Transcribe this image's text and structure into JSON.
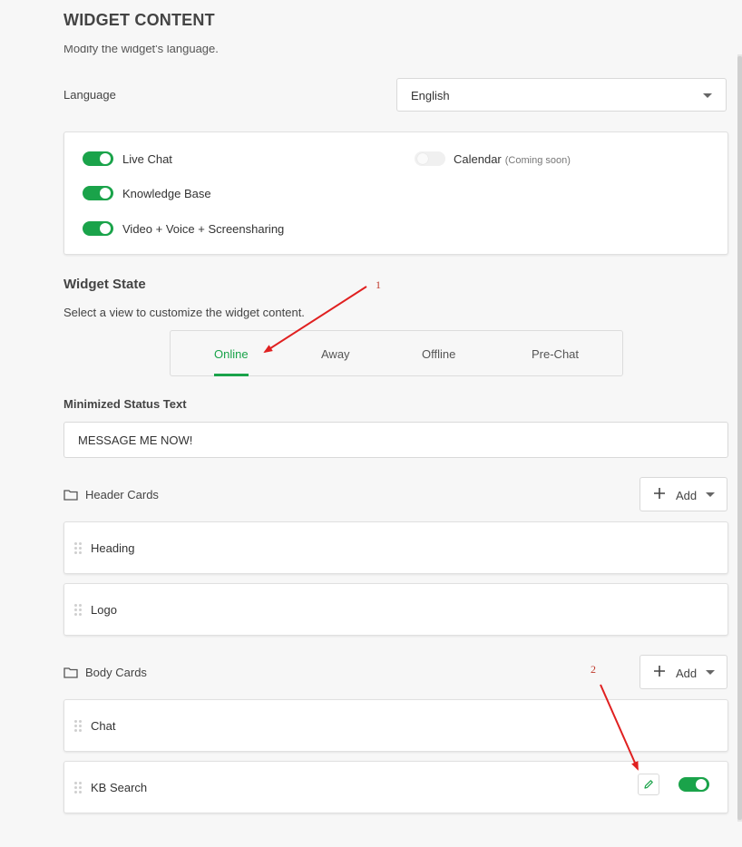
{
  "page": {
    "title": "WIDGET CONTENT",
    "subtitle": "Modify the widget's language."
  },
  "language": {
    "label": "Language",
    "selected": "English"
  },
  "features": [
    {
      "label": "Live Chat",
      "enabled": true
    },
    {
      "label": "Knowledge Base",
      "enabled": true
    },
    {
      "label": "Video + Voice + Screensharing",
      "enabled": true
    },
    {
      "label": "Calendar",
      "note": "(Coming soon)",
      "enabled": false
    }
  ],
  "widget_state": {
    "title": "Widget State",
    "description": "Select a view to customize the widget content.",
    "tabs": [
      {
        "label": "Online",
        "active": true
      },
      {
        "label": "Away",
        "active": false
      },
      {
        "label": "Offline",
        "active": false
      },
      {
        "label": "Pre-Chat",
        "active": false
      }
    ]
  },
  "minimized_status": {
    "label": "Minimized Status Text",
    "value": "MESSAGE ME NOW!"
  },
  "header_cards": {
    "title": "Header Cards",
    "add_label": "Add",
    "items": [
      {
        "label": "Heading"
      },
      {
        "label": "Logo"
      }
    ]
  },
  "body_cards": {
    "title": "Body Cards",
    "add_label": "Add",
    "items": [
      {
        "label": "Chat"
      },
      {
        "label": "KB Search",
        "enabled": true
      }
    ]
  },
  "annotations": [
    "1",
    "2"
  ],
  "colors": {
    "accent": "#1aa34a",
    "annotation": "#e02020"
  }
}
